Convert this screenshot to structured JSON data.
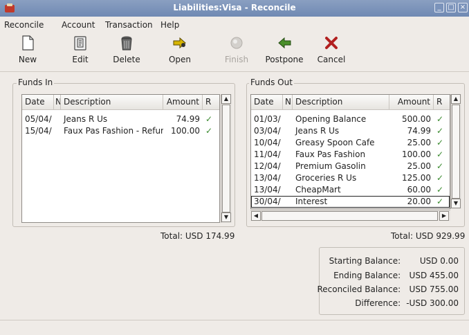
{
  "window": {
    "title": "Liabilities:Visa - Reconcile"
  },
  "menu": [
    "Reconcile",
    "Account",
    "Transaction",
    "Help"
  ],
  "toolbar": {
    "new": "New",
    "edit": "Edit",
    "delete": "Delete",
    "open": "Open",
    "finish": "Finish",
    "postpone": "Postpone",
    "cancel": "Cancel"
  },
  "funds_in": {
    "label": "Funds In",
    "columns": {
      "date": "Date",
      "num": "Num",
      "desc": "Description",
      "amount": "Amount",
      "r": "R"
    },
    "rows": [
      {
        "date": "05/04/",
        "num": "",
        "desc": "Jeans R Us",
        "amount": "74.99",
        "r": "✓"
      },
      {
        "date": "15/04/",
        "num": "",
        "desc": "Faux Pas Fashion - Refund",
        "amount": "100.00",
        "r": "✓"
      }
    ],
    "total": "Total: USD 174.99"
  },
  "funds_out": {
    "label": "Funds Out",
    "columns": {
      "date": "Date",
      "num": "N",
      "desc": "Description",
      "amount": "Amount",
      "r": "R"
    },
    "rows": [
      {
        "date": "01/03/",
        "num": "",
        "desc": "Opening Balance",
        "amount": "500.00",
        "r": "✓"
      },
      {
        "date": "03/04/",
        "num": "",
        "desc": "Jeans R Us",
        "amount": "74.99",
        "r": "✓"
      },
      {
        "date": "10/04/",
        "num": "",
        "desc": "Greasy Spoon Cafe",
        "amount": "25.00",
        "r": "✓"
      },
      {
        "date": "11/04/",
        "num": "",
        "desc": "Faux Pas Fashion",
        "amount": "100.00",
        "r": "✓"
      },
      {
        "date": "12/04/",
        "num": "",
        "desc": "Premium Gasolin",
        "amount": "25.00",
        "r": "✓"
      },
      {
        "date": "13/04/",
        "num": "",
        "desc": "Groceries R Us",
        "amount": "125.00",
        "r": "✓"
      },
      {
        "date": "13/04/",
        "num": "",
        "desc": "CheapMart",
        "amount": "60.00",
        "r": "✓"
      },
      {
        "date": "30/04/",
        "num": "",
        "desc": "Interest",
        "amount": "20.00",
        "r": "✓"
      }
    ],
    "total": "Total: USD 929.99"
  },
  "summary": {
    "starting_label": "Starting Balance:",
    "starting_value": "USD 0.00",
    "ending_label": "Ending Balance:",
    "ending_value": "USD 455.00",
    "reconciled_label": "Reconciled Balance:",
    "reconciled_value": "USD 755.00",
    "difference_label": "Difference:",
    "difference_value": "-USD 300.00"
  },
  "colors": {
    "titlebar": "#7b93bb",
    "check": "#3a8a2e",
    "cancel": "#b22020",
    "open_arrow": "#d6b400",
    "postpone_arrow": "#4a8f2a"
  }
}
